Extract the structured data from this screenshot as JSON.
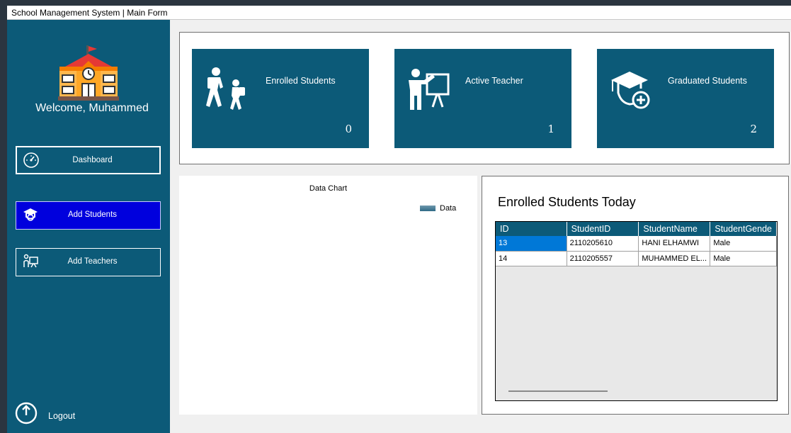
{
  "window": {
    "title": "School Management System | Main Form"
  },
  "sidebar": {
    "welcome": "Welcome, Muhammed",
    "nav": {
      "dashboard": "Dashboard",
      "add_students": "Add Students",
      "add_teachers": "Add Teachers"
    },
    "logout": "Logout"
  },
  "cards": {
    "enrolled": {
      "title": "Enrolled Students",
      "value": "0"
    },
    "teacher": {
      "title": "Active Teacher",
      "value": "1"
    },
    "graduated": {
      "title": "Graduated Students",
      "value": "2"
    }
  },
  "chart_data": {
    "type": "bar",
    "title": "Data Chart",
    "series": [
      {
        "name": "Data",
        "values": []
      }
    ],
    "categories": [],
    "legend": "top-right"
  },
  "grid": {
    "heading": "Enrolled Students Today",
    "columns": [
      "ID",
      "StudentID",
      "StudentName",
      "StudentGende"
    ],
    "rows": [
      [
        "13",
        "2110205610",
        "HANI ELHAMWI",
        "Male"
      ],
      [
        "14",
        "2110205557",
        "MUHAMMED EL...",
        "Male"
      ]
    ]
  },
  "colors": {
    "sidebar": "#0c5a78",
    "card": "#0c5a78",
    "active_nav": "#0000dd",
    "selection": "#0078d7"
  }
}
